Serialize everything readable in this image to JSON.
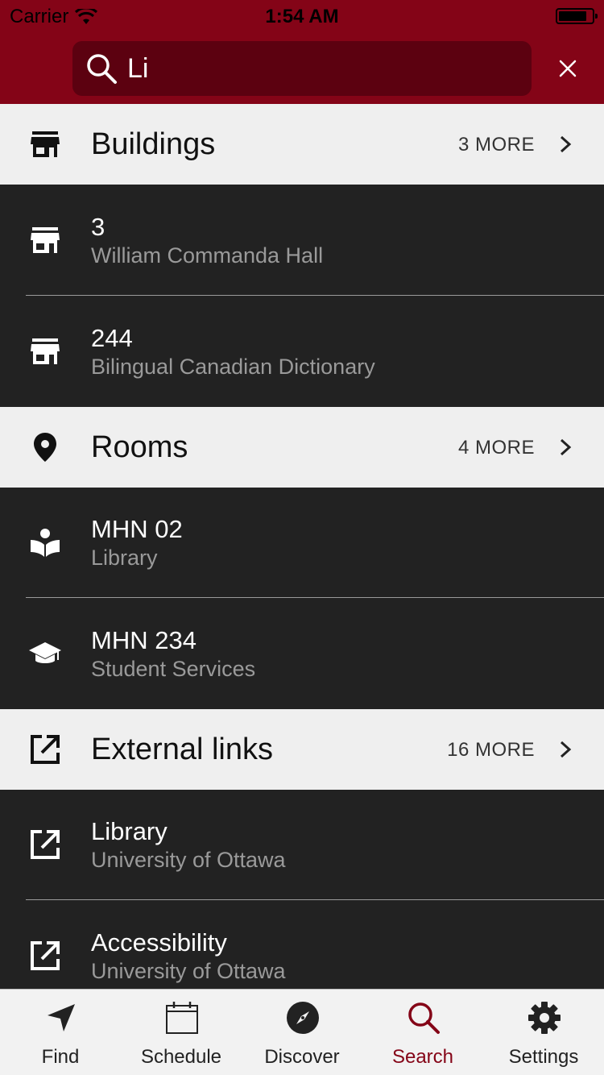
{
  "status_bar": {
    "carrier": "Carrier",
    "time": "1:54 AM"
  },
  "search": {
    "value": "Li",
    "placeholder": ""
  },
  "colors": {
    "brand": "#840417",
    "brand_dark": "#5c0110",
    "header_bg": "#efefef",
    "row_bg": "#222222",
    "subtext": "#9a9a9a"
  },
  "sections": [
    {
      "title": "Buildings",
      "more": "3 MORE",
      "icon": "store-icon",
      "items": [
        {
          "title": "3",
          "subtitle": "William Commanda Hall",
          "icon": "store-icon"
        },
        {
          "title": "244",
          "subtitle": "Bilingual Canadian Dictionary",
          "icon": "store-icon"
        }
      ]
    },
    {
      "title": "Rooms",
      "more": "4 MORE",
      "icon": "map-pin-icon",
      "items": [
        {
          "title": "MHN 02",
          "subtitle": "Library",
          "icon": "reader-icon"
        },
        {
          "title": "MHN 234",
          "subtitle": "Student Services",
          "icon": "graduation-cap-icon"
        }
      ]
    },
    {
      "title": "External links",
      "more": "16 MORE",
      "icon": "external-link-icon",
      "items": [
        {
          "title": "Library",
          "subtitle": "University of Ottawa",
          "icon": "external-link-icon"
        },
        {
          "title": "Accessibility",
          "subtitle": "University of Ottawa",
          "icon": "external-link-icon"
        }
      ]
    }
  ],
  "tabs": [
    {
      "label": "Find",
      "icon": "location-arrow-icon"
    },
    {
      "label": "Schedule",
      "icon": "calendar-icon"
    },
    {
      "label": "Discover",
      "icon": "compass-icon"
    },
    {
      "label": "Search",
      "icon": "search-icon",
      "active": true
    },
    {
      "label": "Settings",
      "icon": "gear-icon"
    }
  ]
}
